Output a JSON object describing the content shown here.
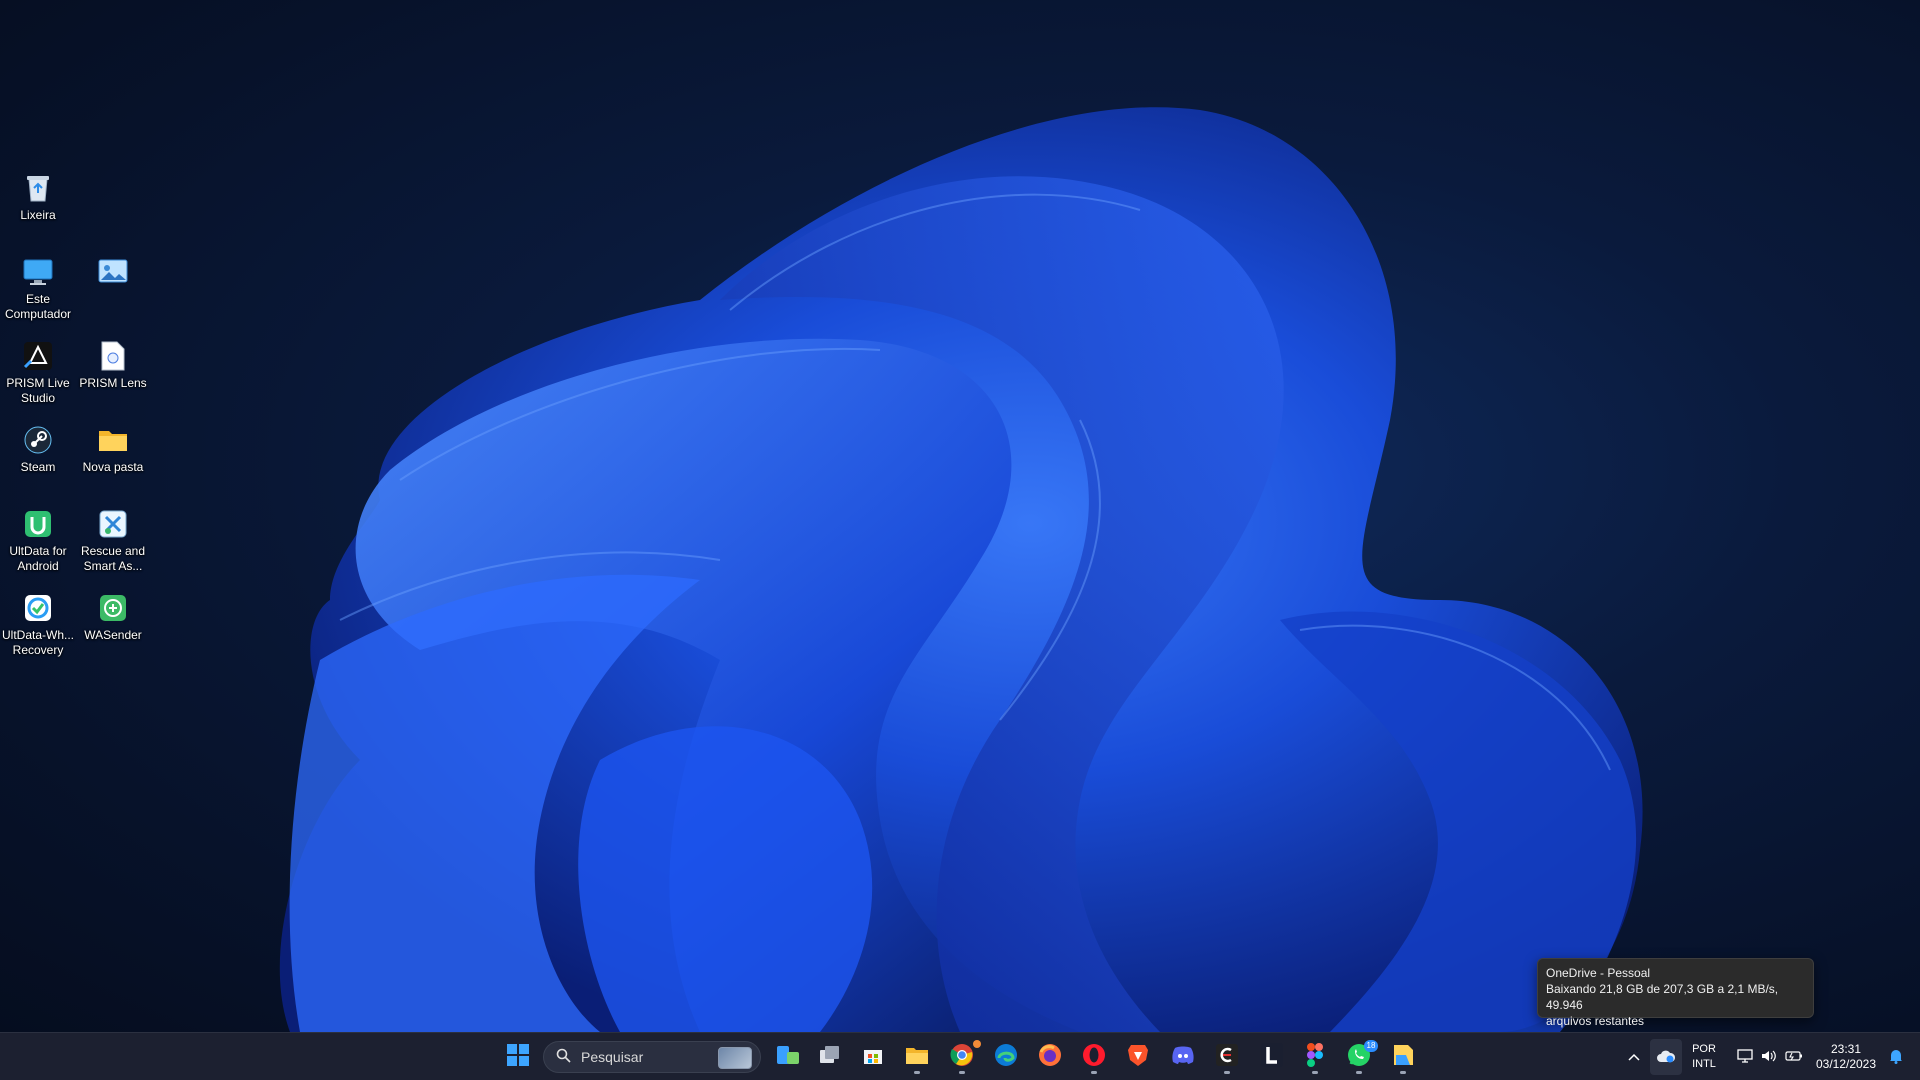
{
  "desktop": {
    "icons": [
      {
        "name": "recycle-bin",
        "label": "Lixeira"
      },
      {
        "name": "this-pc",
        "label": "Este Computador"
      },
      {
        "name": "unnamed-shortcut",
        "label": ""
      },
      {
        "name": "prism-live-studio",
        "label": "PRISM Live Studio"
      },
      {
        "name": "prism-lens",
        "label": "PRISM Lens"
      },
      {
        "name": "steam",
        "label": "Steam"
      },
      {
        "name": "nova-pasta",
        "label": "Nova pasta"
      },
      {
        "name": "ultdata-android",
        "label": "UltData for Android"
      },
      {
        "name": "rescue-smart",
        "label": "Rescue and Smart As..."
      },
      {
        "name": "ultdata-whatsapp",
        "label": "UltData-Wh... Recovery"
      },
      {
        "name": "wasender",
        "label": "WASender"
      }
    ]
  },
  "tooltip": {
    "title": "OneDrive - Pessoal",
    "line1": "Baixando 21,8 GB de 207,3 GB a 2,1 MB/s, 49.946",
    "line2": "arquivos restantes"
  },
  "taskbar": {
    "search_placeholder": "Pesquisar",
    "chrome_badge": "",
    "whatsapp_badge": "18",
    "apps": [
      "start-icon",
      "widgets-icon",
      "task-view-icon",
      "store-icon",
      "file-explorer-icon",
      "chrome-icon",
      "edge-icon",
      "firefox-icon",
      "opera-icon",
      "brave-icon",
      "discord-icon",
      "capcut-icon",
      "l-app-icon",
      "figma-icon",
      "whatsapp-icon",
      "sticky-app-icon"
    ],
    "tray": {
      "lang_top": "POR",
      "lang_bottom": "INTL",
      "time": "23:31",
      "date": "03/12/2023"
    }
  },
  "colors": {
    "taskbar_bg": "#1c2030",
    "accent": "#2a8cff",
    "tooltip_bg": "#2b2b2b"
  }
}
